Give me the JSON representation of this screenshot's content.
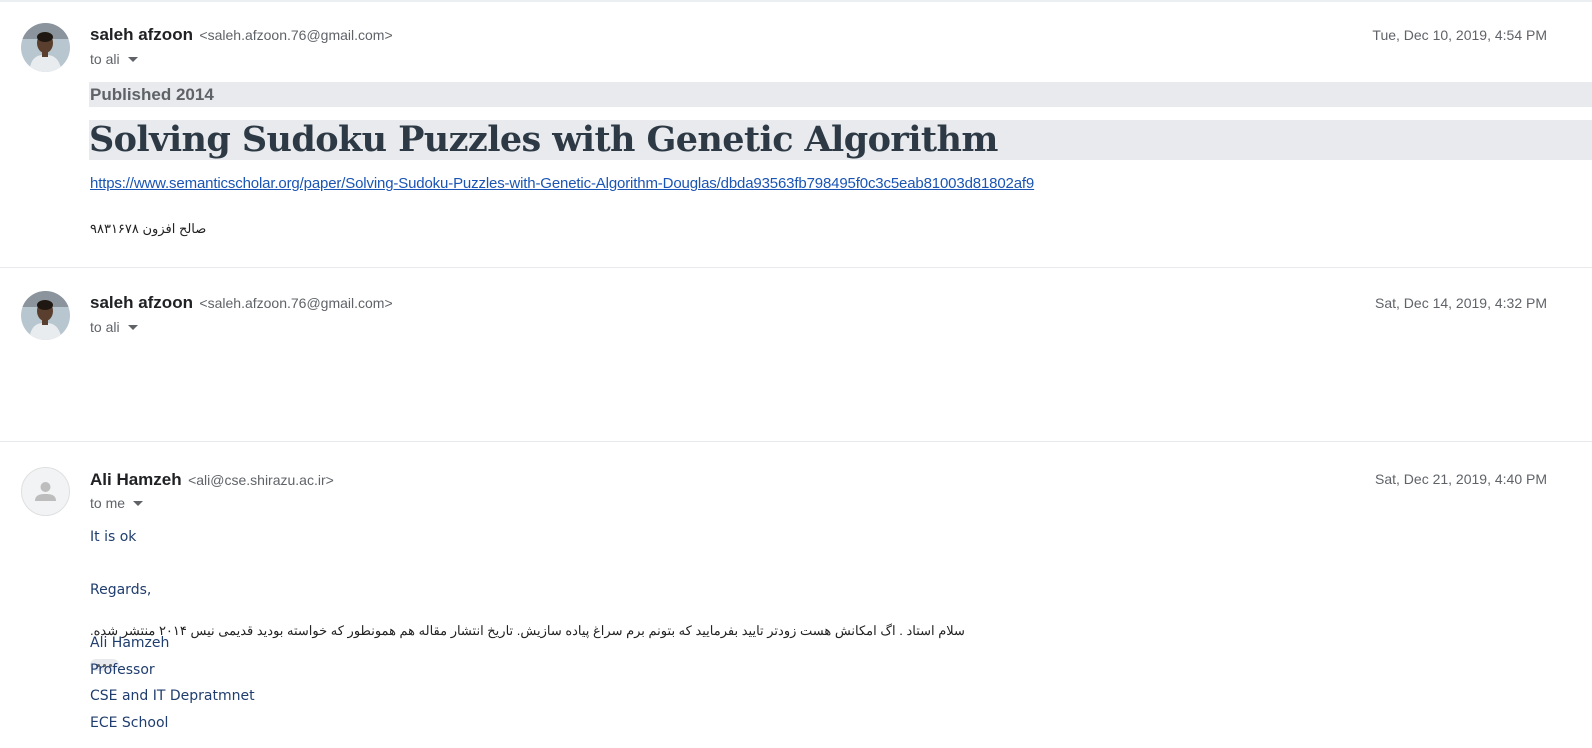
{
  "messages": [
    {
      "sender_name": "saleh afzoon",
      "sender_email": "<saleh.afzoon.76@gmail.com>",
      "recipient": "to ali",
      "date": "Tue, Dec 10, 2019, 4:54 PM",
      "published": "Published 2014",
      "paper_title": "Solving Sudoku Puzzles with Genetic Algorithm",
      "link": "https://www.semanticscholar.org/paper/Solving-Sudoku-Puzzles-with-Genetic-Algorithm-Douglas/dbda93563fb798495f0c3c5eab81003d81802af9",
      "signature": "صالح افزون ۹۸۳۱۶۷۸"
    },
    {
      "sender_name": "saleh afzoon",
      "sender_email": "<saleh.afzoon.76@gmail.com>",
      "recipient": "to ali",
      "date": "Sat, Dec 14, 2019, 4:32 PM",
      "body": "سلام استاد . اگ امکانش هست زودتر تایید بفرمایید که بتونم برم سراغ پیاده سازیش. تاریخ انتشار مقاله هم همونطور که خواسته بودید قدیمی نیس ۲۰۱۴ منتشر شده."
    },
    {
      "sender_name": "Ali Hamzeh",
      "sender_email": "<ali@cse.shirazu.ac.ir>",
      "recipient": "to me",
      "date": "Sat, Dec 21, 2019, 4:40 PM",
      "body_lines": [
        "It is ok",
        "Regards,",
        "Ali Hamzeh",
        "Professor",
        "CSE and IT Depratmnet",
        "ECE School"
      ]
    }
  ]
}
